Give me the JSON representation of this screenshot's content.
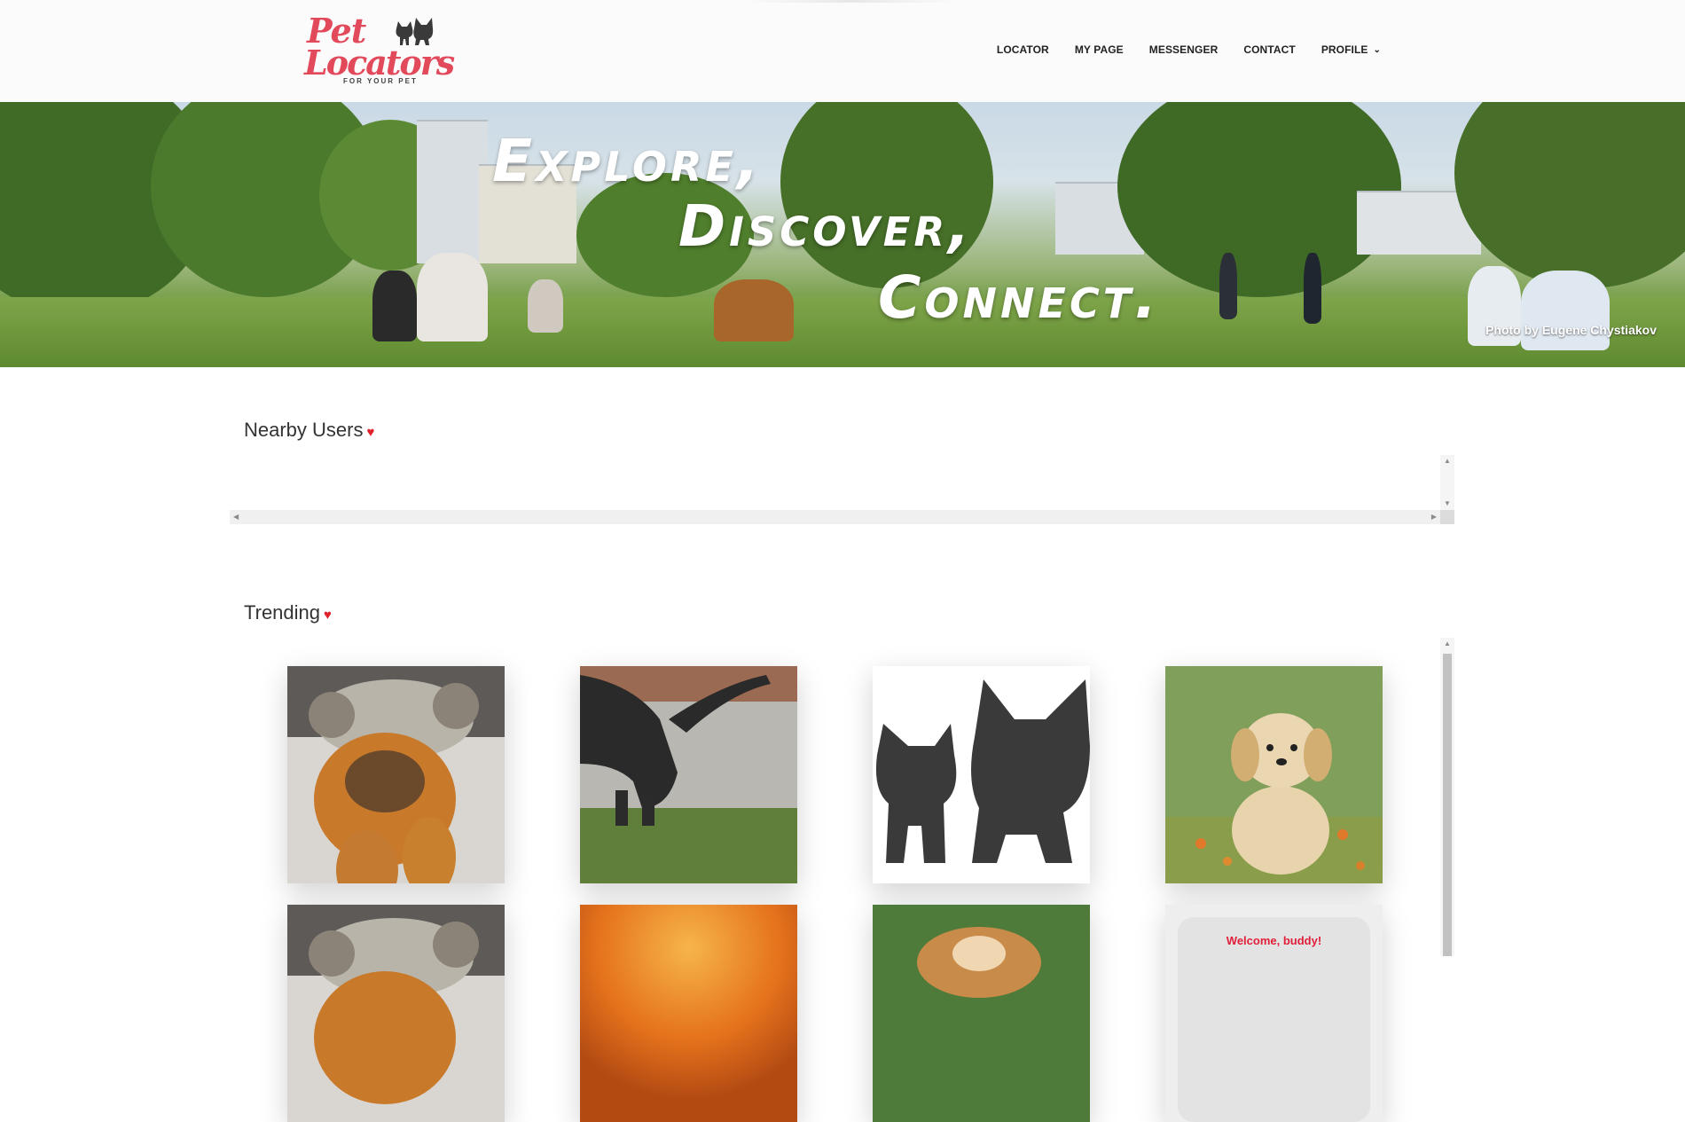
{
  "header": {
    "logo": {
      "line1": "Pet",
      "line2": "Locators",
      "tagline": "FOR YOUR PET"
    },
    "nav": [
      {
        "label": "LOCATOR"
      },
      {
        "label": "MY PAGE"
      },
      {
        "label": "MESSENGER"
      },
      {
        "label": "CONTACT"
      },
      {
        "label": "PROFILE"
      }
    ]
  },
  "hero": {
    "line1": "Explore,",
    "line2": "Discover,",
    "line3": "Connect.",
    "credit": "Photo by Eugene Chystiakov"
  },
  "nearby": {
    "title": "Nearby Users"
  },
  "trending": {
    "title": "Trending",
    "cards": [
      {
        "subject": "dog in orange bear costume"
      },
      {
        "subject": "black cat walking on grass"
      },
      {
        "subject": "pet locators cat and dog icon"
      },
      {
        "subject": "golden retriever puppy in field"
      },
      {
        "subject": "dog in orange bear costume"
      },
      {
        "subject": "orange blurred photo"
      },
      {
        "subject": "beagle puppy"
      },
      {
        "welcome": "Welcome, buddy!"
      }
    ]
  },
  "colors": {
    "brand": "#e24a5c",
    "heart": "#e0202a",
    "welcome": "#e0203a"
  }
}
